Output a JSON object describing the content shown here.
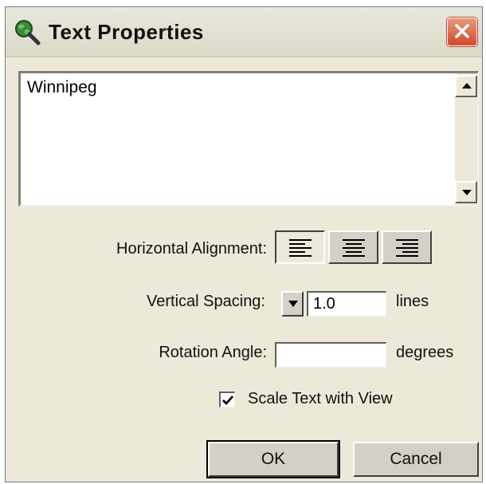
{
  "window": {
    "title": "Text Properties",
    "app_icon": "globe-magnifier-icon",
    "close_icon": "close-icon"
  },
  "text_area": {
    "value": "Winnipeg",
    "scroll_up_icon": "arrow-up-icon",
    "scroll_down_icon": "arrow-down-icon"
  },
  "horizontal_alignment": {
    "label": "Horizontal Alignment:",
    "options": [
      {
        "name": "left",
        "icon": "align-left-icon",
        "selected": true
      },
      {
        "name": "center",
        "icon": "align-center-icon",
        "selected": false
      },
      {
        "name": "right",
        "icon": "align-right-icon",
        "selected": false
      }
    ]
  },
  "vertical_spacing": {
    "label": "Vertical Spacing:",
    "value": "1.0",
    "unit": "lines",
    "dropdown_icon": "arrow-down-icon"
  },
  "rotation_angle": {
    "label": "Rotation Angle:",
    "value": "",
    "unit": "degrees"
  },
  "scale_text": {
    "label": "Scale Text with View",
    "checked": true
  },
  "buttons": {
    "ok": "OK",
    "cancel": "Cancel"
  },
  "colors": {
    "dialog_bg": "#ece9d8",
    "close_button": "#d04a2a"
  }
}
